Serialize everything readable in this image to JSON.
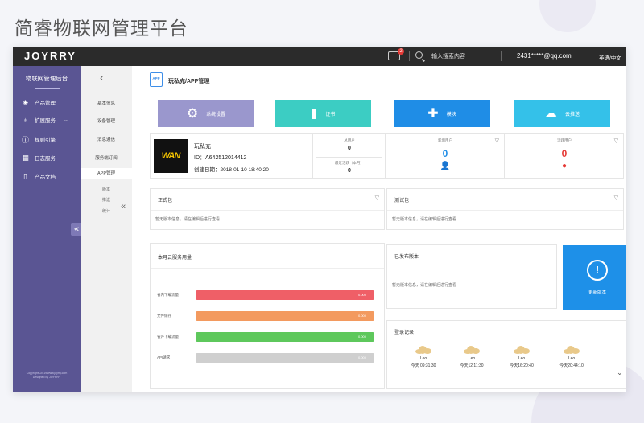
{
  "page_title": "简睿物联网管理平台",
  "topbar": {
    "logo": "JOYRRY",
    "notification_count": "2",
    "search_placeholder": "输入搜索内容",
    "user": "2431*****@qq.com",
    "language": "英语/中文"
  },
  "sidebar": {
    "title": "物联网管理后台",
    "items": [
      {
        "label": "产品管理",
        "icon": "layers-icon"
      },
      {
        "label": "扩展服务",
        "icon": "bulb-icon"
      },
      {
        "label": "规则引擎",
        "icon": "info-icon"
      },
      {
        "label": "日志服务",
        "icon": "calendar-icon"
      },
      {
        "label": "产品文档",
        "icon": "document-icon"
      }
    ],
    "copyright_line1": "Copyright©2019 www.joyrry.com",
    "copyright_line2": "Designed by JOYRRY"
  },
  "subnav": {
    "items": [
      "基本信息",
      "设备管理",
      "消息通信",
      "服务端订阅",
      "APP管理"
    ],
    "active": "APP管理",
    "subitems": [
      "版本",
      "推送",
      "统计"
    ]
  },
  "breadcrumb": {
    "icon_text": "APP",
    "label": "玩私充/APP管理"
  },
  "quick_actions": [
    {
      "label": "系统设置",
      "color": "#9a97cd",
      "icon": "gear-icon"
    },
    {
      "label": "证书",
      "color": "#3ccdc3",
      "icon": "certificate-icon"
    },
    {
      "label": "模块",
      "color": "#1f8de6",
      "icon": "puzzle-icon"
    },
    {
      "label": "云推送",
      "color": "#34c1e9",
      "icon": "cloud-icon"
    }
  ],
  "app_info": {
    "logo_text": "WAN",
    "name": "玩私充",
    "id_line": "ID：A642512014412",
    "created_line": "创建日期：2018-01-10  18:40:20"
  },
  "stats": {
    "total_users_label": "总用户",
    "total_users": "0",
    "recent_active_label": "最近活跃（本月）",
    "recent_active": "0",
    "new_users_label": "新增用户",
    "new_users": "0",
    "active_users_label": "活跃用户",
    "active_users": "0"
  },
  "panels": {
    "official_title": "正式包",
    "official_empty": "暂无版本信息，请在编辑后进行查看",
    "test_title": "测试包",
    "test_empty": "暂无版本信息，请在编辑后进行查看",
    "usage_title": "本月云服务用量",
    "published_title": "已发布版本",
    "published_empty": "暂无版本信息，请在编辑后进行查看",
    "update_label": "更新版本",
    "login_title": "登录记录"
  },
  "usage": [
    {
      "label": "省内下载流量",
      "value": "0.000",
      "color": "#ef5f67",
      "fill": 1.0
    },
    {
      "label": "文件储存",
      "value": "0.000",
      "color": "#f39a5f",
      "fill": 1.0
    },
    {
      "label": "省外下载流量",
      "value": "0.000",
      "color": "#5ec85c",
      "fill": 1.0
    },
    {
      "label": "API请求",
      "value": "0.000",
      "color": "#cfcfcf",
      "fill": 1.0
    }
  ],
  "logins": [
    {
      "user": "Leo",
      "time": "今天 09:31:30"
    },
    {
      "user": "Leo",
      "time": "今天12:11:30"
    },
    {
      "user": "Leo",
      "time": "今天16:20:40"
    },
    {
      "user": "Leo",
      "time": "今天20:44:10"
    }
  ]
}
